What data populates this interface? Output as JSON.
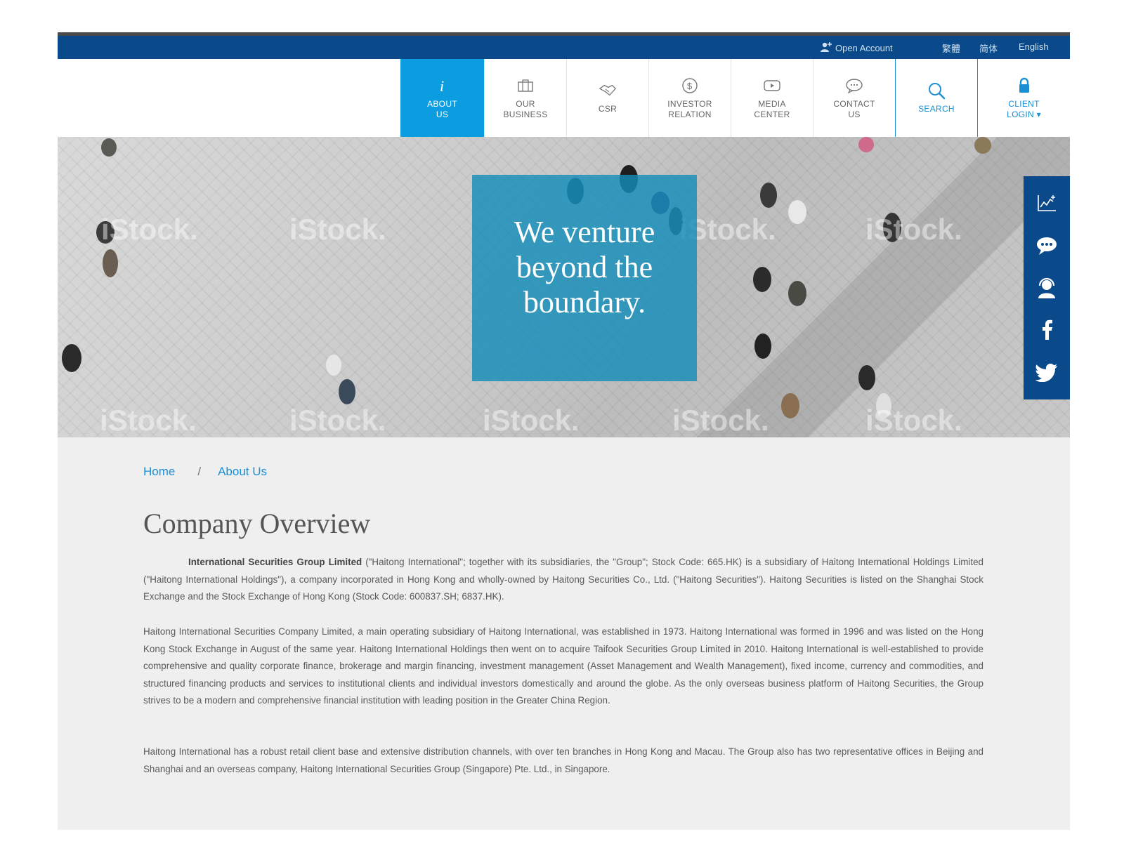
{
  "topbar": {
    "open_account": "Open Account",
    "traditional": "繁體",
    "simplified": "简体",
    "english": "English"
  },
  "nav": {
    "items": [
      {
        "label": "ABOUT\nUS",
        "icon": "info-icon"
      },
      {
        "label": "OUR\nBUSINESS",
        "icon": "briefcase-icon"
      },
      {
        "label": "CSR",
        "icon": "handshake-icon"
      },
      {
        "label": "INVESTOR\nRELATION",
        "icon": "dollar-coin-icon"
      },
      {
        "label": "MEDIA\nCENTER",
        "icon": "play-icon"
      },
      {
        "label": "CONTACT\nUS",
        "icon": "chat-bubble-icon"
      },
      {
        "label": "SEARCH",
        "icon": "search-icon"
      },
      {
        "label": "CLIENT\nLOGIN ▾",
        "icon": "lock-icon"
      }
    ],
    "active": "ABOUT US"
  },
  "hero": {
    "tagline": "We venture\nbeyond the\nboundary.",
    "watermark": "iStock."
  },
  "sidebar": {
    "icons": [
      "chart-icon",
      "chat-icon",
      "support-agent-icon",
      "facebook-icon",
      "twitter-icon"
    ]
  },
  "breadcrumb": {
    "home": "Home",
    "separator": "/",
    "current": "About Us"
  },
  "content": {
    "title": "Company Overview",
    "p1_bold": "International Securities Group Limited",
    "p1_rest": " (\"Haitong International\"; together with its subsidiaries, the \"Group\"; Stock Code: 665.HK) is a subsidiary of Haitong International Holdings Limited (\"Haitong International Holdings\"), a company incorporated in Hong Kong and wholly-owned by Haitong Securities Co., Ltd. (\"Haitong Securities\"). Haitong Securities is listed on the Shanghai Stock Exchange and the Stock Exchange of Hong Kong (Stock Code: 600837.SH; 6837.HK).",
    "p2": "Haitong International Securities Company Limited, a main operating subsidiary of Haitong International, was established in 1973. Haitong International was formed in 1996 and was listed on the Hong Kong Stock Exchange in August of the same year. Haitong International Holdings then went on to acquire Taifook Securities Group Limited in 2010. Haitong International is well-established to provide comprehensive and quality corporate finance, brokerage and margin financing, investment management (Asset Management and Wealth Management), fixed income, currency and commodities, and structured financing products and services to institutional clients and individual investors domestically and around the globe. As the only overseas business platform of Haitong Securities, the Group strives to be a modern and comprehensive financial institution with leading position in the Greater China Region.",
    "p3": "Haitong International has a robust retail client base and extensive distribution channels, with over ten branches in Hong Kong and Macau. The Group also has two representative offices in Beijing and Shanghai and an overseas company, Haitong International Securities Group (Singapore) Pte. Ltd., in Singapore."
  },
  "colors": {
    "brand_navy": "#0a4a8a",
    "active_blue": "#0b9de0",
    "link_blue": "#1a8fd4",
    "tag_box": "#148cb9"
  }
}
